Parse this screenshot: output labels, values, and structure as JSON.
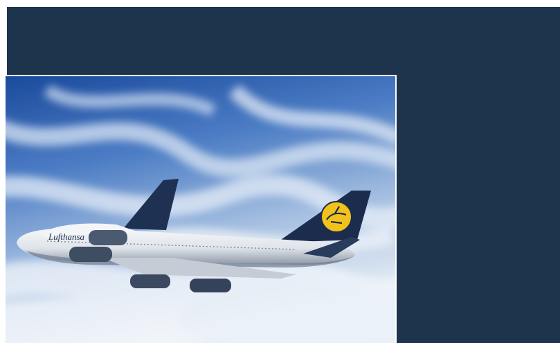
{
  "colors": {
    "panel": "#1e344c",
    "frame": "#ffffff",
    "sky_top": "#1d4fa0",
    "sky_bottom": "#dfe8f2",
    "fuselage": "#eef1f4",
    "fuselage_dark": "#22355a",
    "tail": "#1c2d4e",
    "logo_disc": "#f2c21a"
  },
  "photo": {
    "airline_wordmark": "Lufthansa",
    "icons": [
      "crane-logo-icon"
    ]
  }
}
